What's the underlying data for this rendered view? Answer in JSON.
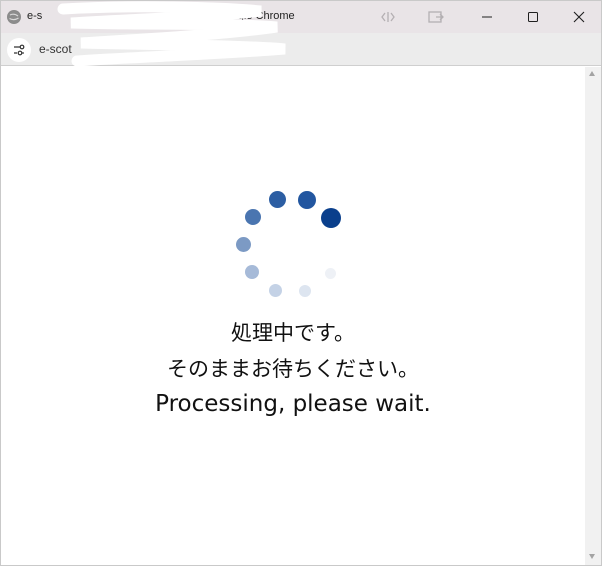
{
  "window": {
    "title_prefix": "e-s",
    "app_name": "Google Chrome",
    "minimize_icon": "minimize-icon",
    "maximize_icon": "maximize-icon",
    "close_icon": "close-icon"
  },
  "addressbar": {
    "url": "e-scot"
  },
  "page": {
    "message_ja_line1": "処理中です。",
    "message_ja_line2": "そのままお待ちください。",
    "message_en": "Processing, please wait."
  },
  "spinner": {
    "icon": "loading-spinner-icon",
    "colors": [
      "#0a3f8c",
      "#2256a0",
      "#2c5ea3",
      "#4a75b0",
      "#7c9ac4",
      "#a6bad8",
      "#c4d2e6",
      "#dde5f0",
      "#eef1f6"
    ]
  },
  "colors": {
    "titlebar_bg": "#e9e4e7",
    "addressbar_bg": "#ececec",
    "spinner_accent": "#0a3f8c"
  }
}
